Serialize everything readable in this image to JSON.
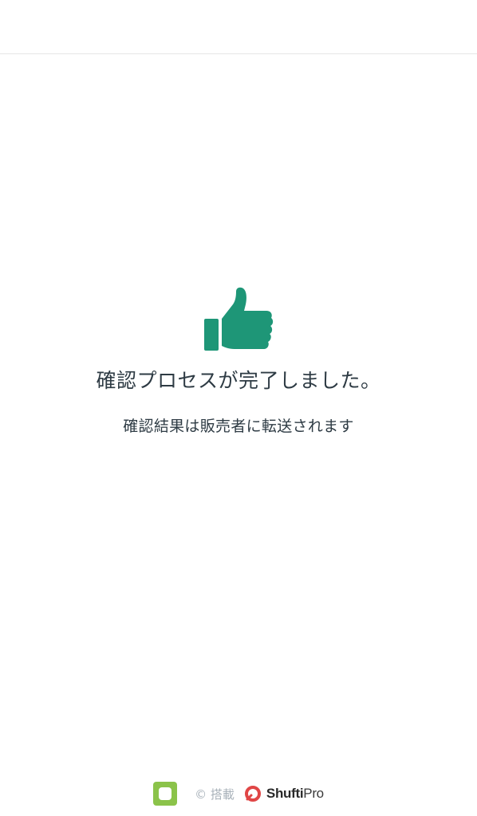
{
  "result": {
    "title": "確認プロセスが完了しました。",
    "message": "確認結果は販売者に転送されます",
    "icon": "thumbs-up-icon",
    "accent_color": "#1e9677"
  },
  "footer": {
    "app_icon": "app-icon",
    "app_icon_color": "#8bc34a",
    "powered_by": "© 搭載",
    "brand_logo": "shufti-pro-logo-icon",
    "brand_logo_color": "#e04646",
    "brand_name_bold": "Shufti",
    "brand_name_light": "Pro"
  }
}
